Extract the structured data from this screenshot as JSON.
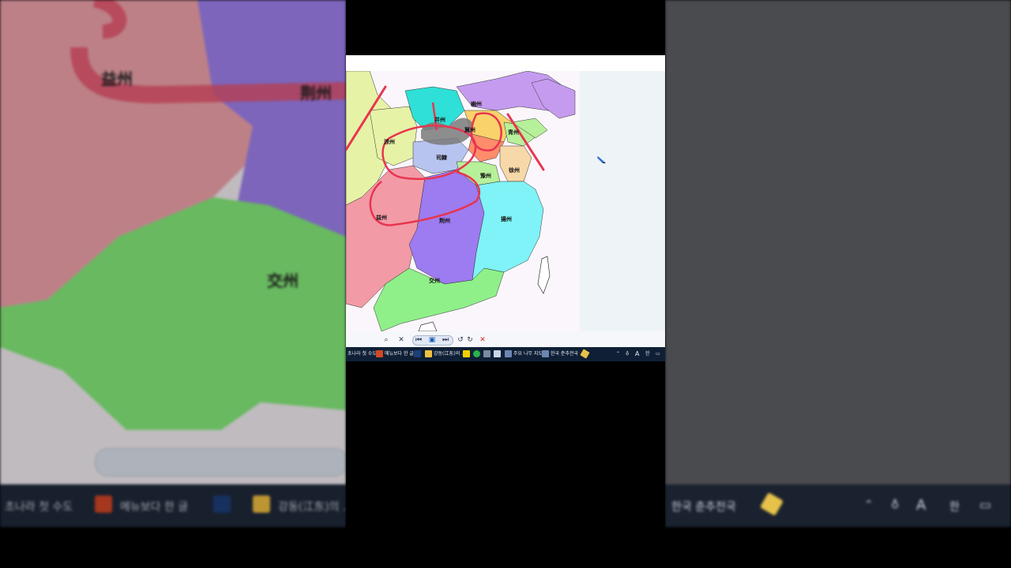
{
  "map": {
    "regions": {
      "yizhou": "益州",
      "jingzhou": "荆州",
      "jiaozhou": "交州",
      "yangzhou": "揚州",
      "xuzhou": "徐州",
      "sili": "司隸",
      "liangzhou": "涼州",
      "bingzhou": "并州",
      "youzhou": "幽州",
      "qingzhou": "青州",
      "yuzhou": "豫州",
      "jizhou": "冀州"
    }
  },
  "taskbar": {
    "items": {
      "first_capital": "초나라 첫 수도",
      "ppt": "메뉴보다 한 글",
      "folder": "강동(江东)의 ...",
      "window1": "주요 나무 지도",
      "window2": "한국 춘추전국"
    },
    "tray": {
      "ime": "A",
      "lang": "한"
    }
  },
  "colors": {
    "taskbar": "#0f2036",
    "yizhou": "#f29aa6",
    "jingzhou": "#9d7bf0",
    "jiaozhou": "#8ff08a",
    "yangzhou": "#7ff3f7",
    "liangzhou": "#e6f2a6",
    "bingzhou": "#2ee0d8",
    "youzhou": "#c59bf0",
    "annotation": "#e83550"
  }
}
